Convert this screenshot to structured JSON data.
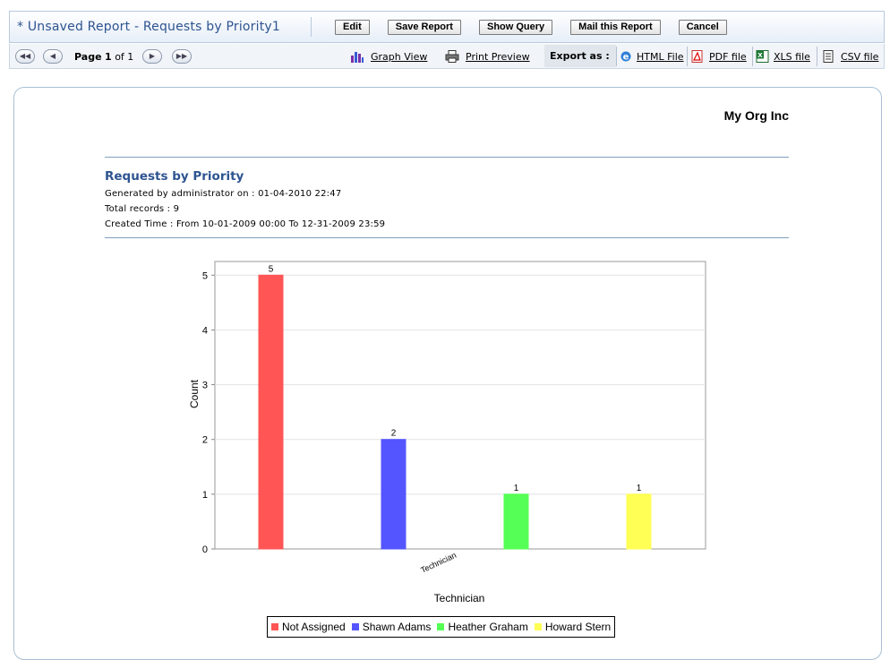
{
  "header": {
    "title": "* Unsaved Report - Requests by Priority1",
    "buttons": [
      "Edit",
      "Save Report",
      "Show Query",
      "Mail this Report",
      "Cancel"
    ]
  },
  "toolbar": {
    "page_label": "Page",
    "page_current": "1",
    "page_of": "of 1",
    "graph_view": "Graph View",
    "print_preview": "Print Preview",
    "export_as": "Export as :",
    "exports": [
      "HTML File",
      "PDF file",
      "XLS file",
      "CSV file"
    ]
  },
  "report": {
    "org": "My Org Inc",
    "title": "Requests by Priority",
    "generated": "Generated by administrator  on : 01-04-2010 22:47",
    "total_records": "Total records : 9",
    "created_time": "Created Time : From 10-01-2009 00:00 To 12-31-2009 23:59"
  },
  "chart_data": {
    "type": "bar",
    "categories": [
      "Technician"
    ],
    "series": [
      {
        "name": "Not Assigned",
        "values": [
          5
        ],
        "color": "#ff5555"
      },
      {
        "name": "Shawn Adams",
        "values": [
          2
        ],
        "color": "#5555ff"
      },
      {
        "name": "Heather Graham",
        "values": [
          1
        ],
        "color": "#55ff55"
      },
      {
        "name": "Howard Stern",
        "values": [
          1
        ],
        "color": "#ffff55"
      }
    ],
    "xlabel": "Technician",
    "ylabel": "Count",
    "ylim": [
      0,
      5.25
    ],
    "yticks": [
      0,
      1,
      2,
      3,
      4,
      5
    ],
    "grid": true,
    "legend": "bottom"
  }
}
